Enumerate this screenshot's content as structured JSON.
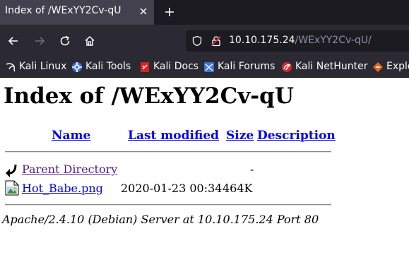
{
  "browser": {
    "tab": {
      "title": "Index of /WExYY2Cv-qU"
    },
    "url": {
      "host": "10.10.175.24",
      "path": "/WExYY2Cv-qU/"
    },
    "bookmarks": [
      {
        "label": "Kali Linux",
        "icon": "kali-dragon-icon"
      },
      {
        "label": "Kali Tools",
        "icon": "kali-tools-icon"
      },
      {
        "label": "Kali Docs",
        "icon": "kali-docs-icon"
      },
      {
        "label": "Kali Forums",
        "icon": "kali-forums-icon"
      },
      {
        "label": "Kali NetHunter",
        "icon": "nethunter-icon"
      },
      {
        "label": "Explo",
        "icon": "exploit-db-icon"
      }
    ]
  },
  "page": {
    "heading": "Index of /WExYY2Cv-qU",
    "columns": {
      "name": "Name",
      "last_modified": "Last modified",
      "size": "Size",
      "description": "Description"
    },
    "rows": [
      {
        "name": "Parent Directory",
        "last_modified": "",
        "size": "-",
        "description": "",
        "icon": "back-arrow-icon"
      },
      {
        "name": "Hot_Babe.png",
        "last_modified": "2020-01-23 00:34",
        "size": "464K",
        "description": "",
        "icon": "image-file-icon"
      }
    ],
    "address": "Apache/2.4.10 (Debian) Server at 10.10.175.24 Port 80"
  }
}
